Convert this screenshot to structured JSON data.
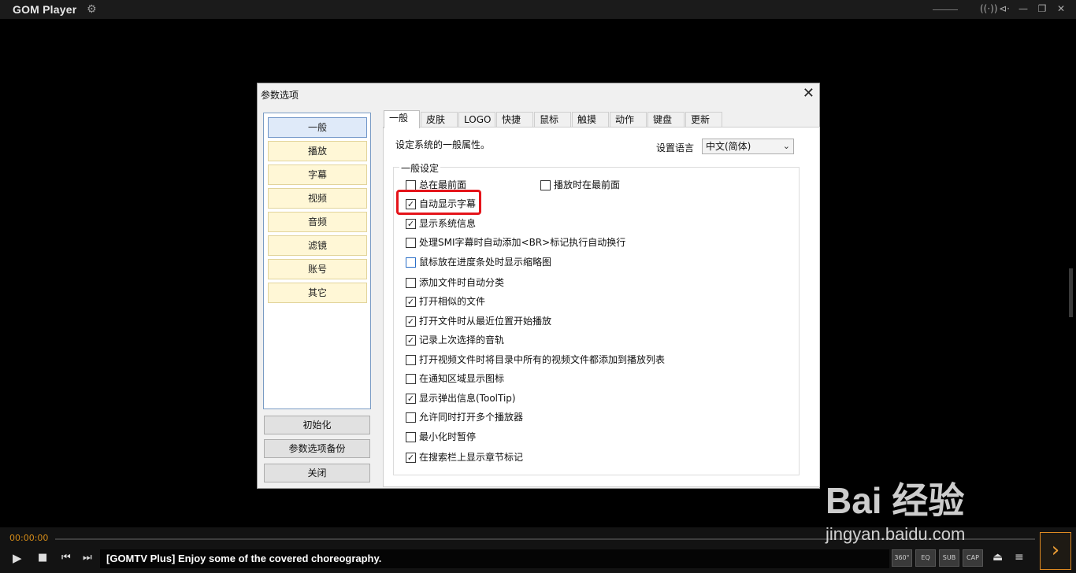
{
  "titlebar": {
    "app_name": "GOM Player",
    "gear_icon": "gear-icon",
    "window_icons": [
      "minimize-icon",
      "restore-icon",
      "close-icon"
    ]
  },
  "dialog": {
    "title": "参数选项",
    "nav": [
      "一般",
      "播放",
      "字幕",
      "视频",
      "音频",
      "滤镜",
      "账号",
      "其它"
    ],
    "buttons": {
      "reset": "初始化",
      "backup": "参数选项备份",
      "close": "关闭"
    },
    "tabs": [
      "一般",
      "皮肤",
      "LOGO",
      "快捷",
      "鼠标",
      "触摸",
      "动作",
      "键盘",
      "更新"
    ],
    "description": "设定系统的一般属性。",
    "language_label": "设置语言",
    "language_value": "中文(简体)",
    "group_title": "一般设定",
    "options": [
      {
        "label": "总在最前面",
        "checked": false
      },
      {
        "label": "播放时在最前面",
        "checked": false
      },
      {
        "label": "自动显示字幕",
        "checked": true
      },
      {
        "label": "显示系统信息",
        "checked": true
      },
      {
        "label": "处理SMI字幕时自动添加<BR>标记执行自动换行",
        "checked": false
      },
      {
        "label": "鼠标放在进度条处时显示缩略图",
        "checked": false
      },
      {
        "label": "添加文件时自动分类",
        "checked": false
      },
      {
        "label": "打开相似的文件",
        "checked": true
      },
      {
        "label": "打开文件时从最近位置开始播放",
        "checked": true
      },
      {
        "label": "记录上次选择的音轨",
        "checked": true
      },
      {
        "label": "打开视频文件时将目录中所有的视频文件都添加到播放列表",
        "checked": false
      },
      {
        "label": "在通知区域显示图标",
        "checked": false
      },
      {
        "label": "显示弹出信息(ToolTip)",
        "checked": true
      },
      {
        "label": "允许同时打开多个播放器",
        "checked": false
      },
      {
        "label": "最小化时暂停",
        "checked": false
      },
      {
        "label": "在搜索栏上显示章节标记",
        "checked": true
      }
    ],
    "highlight_color": "#e5141a"
  },
  "player": {
    "time": "00:00:00",
    "ticker": "[GOMTV Plus] Enjoy some of the covered choreography.",
    "right_buttons": [
      "360°",
      "EQ",
      "SUB",
      "CAP"
    ],
    "accent": "#e08a22"
  },
  "watermark": {
    "main": "Bai 经验",
    "url": "jingyan.baidu.com"
  }
}
